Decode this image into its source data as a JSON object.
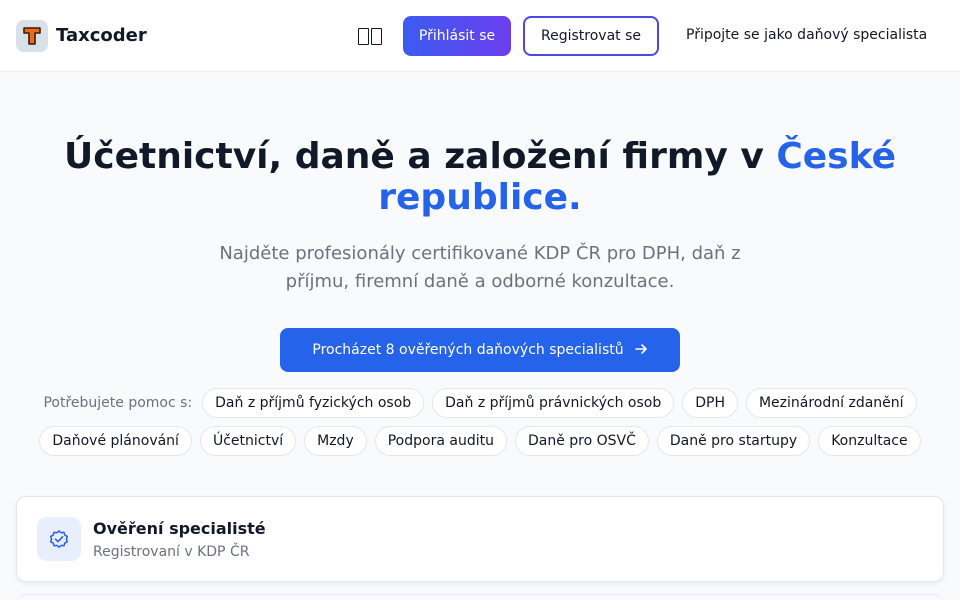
{
  "header": {
    "brand": "Taxcoder",
    "login_label": "Přihlásit se",
    "register_label": "Registrovat se",
    "specialist_link": "Připojte se jako daňový specialista"
  },
  "hero": {
    "title_main": "Účetnictví, daně a založení firmy v ",
    "title_accent": "České republice.",
    "subtitle": "Najděte profesionály certifikované KDP ČR pro DPH, daň z příjmu, firemní daně a odborné konzultace.",
    "cta_label": "Procházet 8 ověřených daňových specialistů"
  },
  "help": {
    "label": "Potřebujete pomoc s:",
    "tags": [
      "Daň z příjmů fyzických osob",
      "Daň z příjmů právnických osob",
      "DPH",
      "Mezinárodní zdanění",
      "Daňové plánování",
      "Účetnictví",
      "Mzdy",
      "Podpora auditu",
      "Daně pro OSVČ",
      "Daně pro startupy",
      "Konzultace"
    ]
  },
  "feature": {
    "title": "Ověření specialisté",
    "subtitle": "Registrovaní v KDP ČR"
  },
  "colors": {
    "accent": "#2563eb",
    "login_gradient_start": "#3b5cf0",
    "login_gradient_end": "#6d3ef0",
    "register_border": "#4f46e5",
    "logo_orange": "#ea6a1f"
  },
  "icons": {
    "logo": "t-logo-icon",
    "language": "language-icon",
    "arrow": "arrow-right-icon",
    "verified": "badge-check-icon"
  }
}
